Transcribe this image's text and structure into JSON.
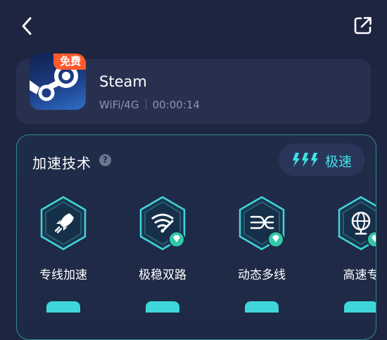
{
  "app": {
    "name": "Steam",
    "network": "WiFi/4G",
    "timer": "00:00:14",
    "badge": "免费",
    "icon": "steam-logo"
  },
  "acceleration": {
    "title": "加速技术",
    "mode_label": "极速",
    "features": [
      {
        "label": "专线加速",
        "icon": "rocket-icon",
        "premium": false
      },
      {
        "label": "极稳双路",
        "icon": "signal-icon",
        "premium": true
      },
      {
        "label": "动态多线",
        "icon": "multiline-icon",
        "premium": true
      },
      {
        "label": "高速专",
        "icon": "globe-icon",
        "premium": true
      }
    ]
  },
  "colors": {
    "background": "#1d2540",
    "card": "#27304e",
    "accent": "#3fe3e6",
    "badge": "#ff5a2c",
    "premium_gem": "#33c9a8"
  }
}
